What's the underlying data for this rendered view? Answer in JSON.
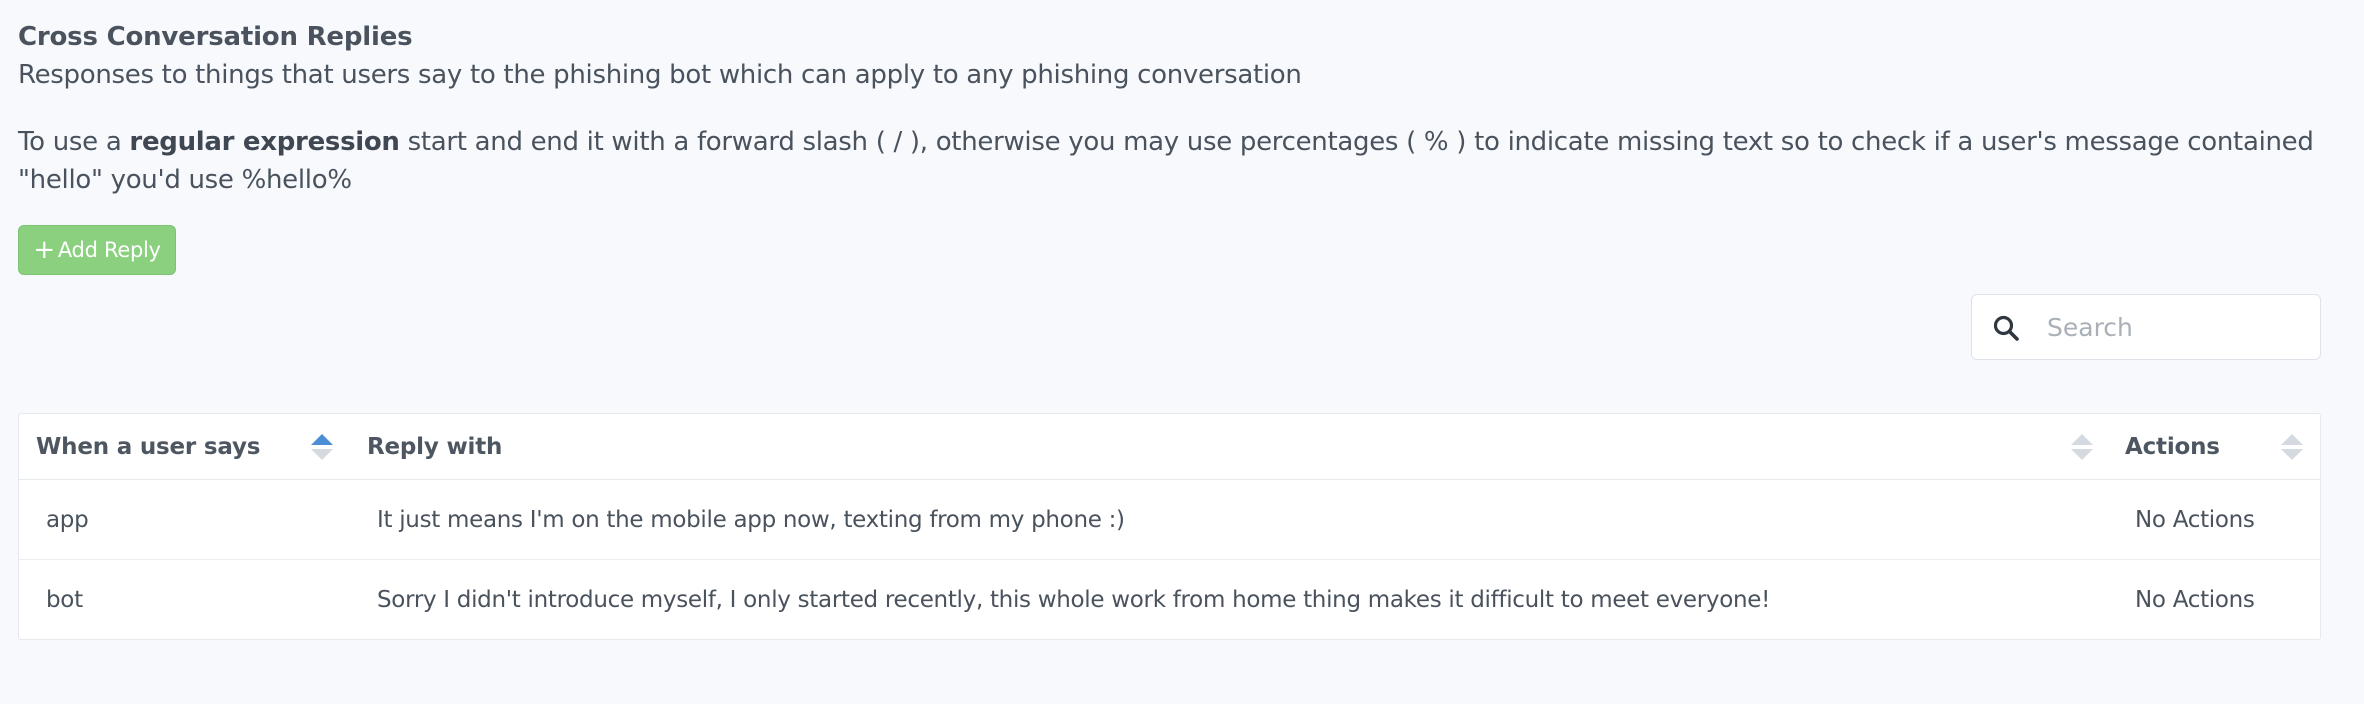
{
  "header": {
    "title": "Cross Conversation Replies",
    "subtitle": "Responses to things that users say to the phishing bot which can apply to any phishing conversation"
  },
  "help": {
    "prefix": "To use a ",
    "bold": "regular expression",
    "suffix": " start and end it with a forward slash ( / ), otherwise you may use percentages ( % ) to indicate missing text so to check if a user's message contained \"hello\" you'd use %hello%"
  },
  "toolbar": {
    "add_icon": "+",
    "add_label": "Add Reply"
  },
  "search": {
    "placeholder": "Search",
    "value": "",
    "icon": "search-icon"
  },
  "table": {
    "columns": [
      {
        "label": "When a user says",
        "sort": "ascending"
      },
      {
        "label": "Reply with",
        "sort": "none"
      },
      {
        "label": "Actions",
        "sort": "none"
      }
    ],
    "rows": [
      {
        "when": "app",
        "reply": "It just means I'm on the mobile app now, texting from my phone :)",
        "actions": "No Actions"
      },
      {
        "when": "bot",
        "reply": "Sorry I didn't introduce myself, I only started recently, this whole work from home thing makes it difficult to meet everyone!",
        "actions": "No Actions"
      }
    ]
  },
  "colors": {
    "background": "#f7f9fd",
    "add_button": "#8ad07e",
    "sort_active": "#4a8fd6",
    "sort_inactive": "#d5dae0"
  }
}
